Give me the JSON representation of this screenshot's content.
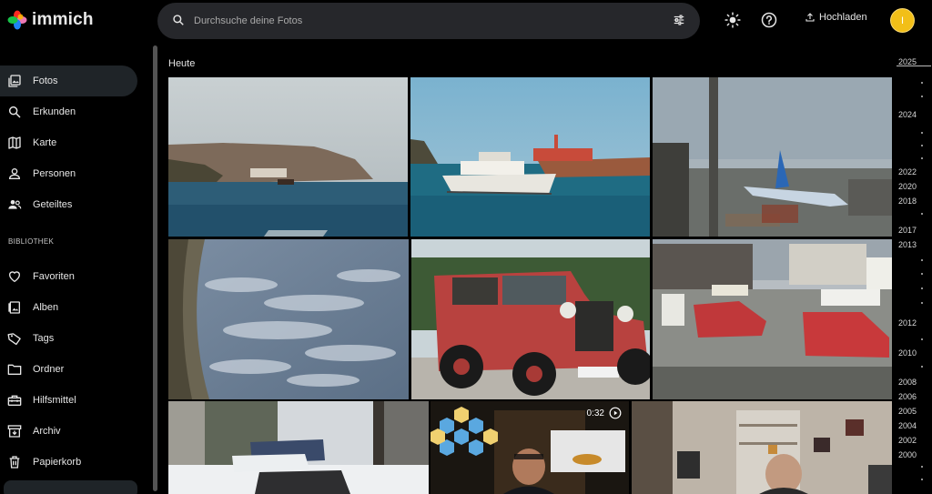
{
  "app": {
    "name": "immich"
  },
  "search": {
    "placeholder": "Durchsuche deine Fotos"
  },
  "header": {
    "upload_label": "Hochladen",
    "avatar_initial": "I",
    "avatar_color": "#f2bf18"
  },
  "sidebar": {
    "items": [
      {
        "label": "Fotos",
        "icon": "photos-icon",
        "active": true
      },
      {
        "label": "Erkunden",
        "icon": "magnify-icon"
      },
      {
        "label": "Karte",
        "icon": "map-icon"
      },
      {
        "label": "Personen",
        "icon": "person-icon"
      },
      {
        "label": "Geteiltes",
        "icon": "shared-icon"
      }
    ],
    "library_label": "BIBLIOTHEK",
    "library_items": [
      {
        "label": "Favoriten",
        "icon": "heart-icon"
      },
      {
        "label": "Alben",
        "icon": "album-icon"
      },
      {
        "label": "Tags",
        "icon": "tag-icon"
      },
      {
        "label": "Ordner",
        "icon": "folder-icon"
      },
      {
        "label": "Hilfsmittel",
        "icon": "toolbox-icon"
      },
      {
        "label": "Archiv",
        "icon": "archive-icon"
      },
      {
        "label": "Papierkorb",
        "icon": "trash-icon"
      }
    ]
  },
  "main": {
    "day_title": "Heute",
    "video_duration": "0:32"
  },
  "timeline": {
    "years": [
      "2025",
      "2024",
      "2022",
      "2020",
      "2018",
      "2017",
      "2013",
      "2012",
      "2010",
      "2008",
      "2006",
      "2005",
      "2004",
      "2002",
      "2000"
    ]
  }
}
